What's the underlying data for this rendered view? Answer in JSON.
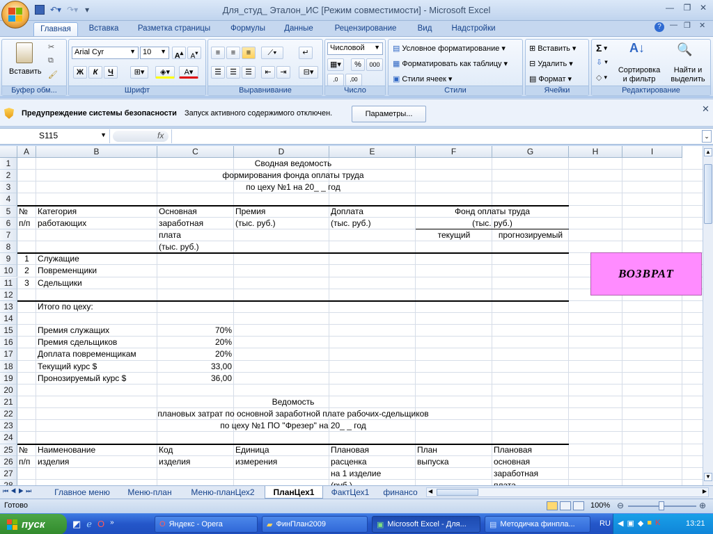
{
  "window": {
    "title": "Для_студ_ Эталон_ИС  [Режим совместимости] - Microsoft Excel"
  },
  "ribbon_tabs": [
    "Главная",
    "Вставка",
    "Разметка страницы",
    "Формулы",
    "Данные",
    "Рецензирование",
    "Вид",
    "Надстройки"
  ],
  "ribbon": {
    "clipboard": {
      "paste": "Вставить",
      "label": "Буфер обм..."
    },
    "font": {
      "name": "Arial Cyr",
      "size": "10",
      "bold": "Ж",
      "italic": "К",
      "underline": "Ч",
      "label": "Шрифт"
    },
    "alignment": {
      "label": "Выравнивание"
    },
    "number": {
      "format": "Числовой",
      "percent": "%",
      "thousands": "000",
      "label": "Число"
    },
    "styles": {
      "conditional": "Условное форматирование",
      "as_table": "Форматировать как таблицу",
      "cell_styles": "Стили ячеек",
      "label": "Стили"
    },
    "cells": {
      "insert": "Вставить",
      "delete": "Удалить",
      "format": "Формат",
      "label": "Ячейки"
    },
    "editing": {
      "sort": "Сортировка и фильтр",
      "find": "Найти и выделить",
      "label": "Редактирование"
    }
  },
  "security": {
    "title": "Предупреждение системы безопасности",
    "message": "Запуск активного содержимого отключен.",
    "button": "Параметры..."
  },
  "formula_bar": {
    "name_box": "S115",
    "fx": "fx",
    "value": ""
  },
  "columns": [
    "A",
    "B",
    "C",
    "D",
    "E",
    "F",
    "G",
    "H",
    "I"
  ],
  "rows": [
    "1",
    "2",
    "3",
    "4",
    "5",
    "6",
    "7",
    "8",
    "9",
    "10",
    "11",
    "12",
    "13",
    "14",
    "15",
    "16",
    "17",
    "18",
    "19",
    "20",
    "21",
    "22",
    "23",
    "24",
    "25",
    "26",
    "27",
    "28"
  ],
  "cells": {
    "r1": "Сводная ведомость",
    "r2": "формирования фонда оплаты труда",
    "r3": "по цеху №1 на 20_ _ год",
    "h5a": "№",
    "h6a": "п/п",
    "h5b": "Категория",
    "h6b": "работающих",
    "h5c": "Основная",
    "h6c": "заработная",
    "h7c": "плата",
    "h8c": "(тыс. руб.)",
    "h5d": "Премия",
    "h6d": "(тыс. руб.)",
    "h5e": "Доплата",
    "h6e": "(тыс. руб.)",
    "h5fg": "Фонд оплаты труда",
    "h6fg": "(тыс. руб.)",
    "h7f": "текущий",
    "h7g": "прогнозируемый",
    "r9a": "1",
    "r9b": "Служащие",
    "r10a": "2",
    "r10b": "Повременщики",
    "r11a": "3",
    "r11b": "Сдельщики",
    "r13b": "Итого по цеху:",
    "r15b": "Премия служащих",
    "r15c": "70%",
    "r16b": "Премия сдельщиков",
    "r16c": "20%",
    "r17b": "Доплата повременщикам",
    "r17c": "20%",
    "r18b": "Текущий курс $",
    "r18c": "33,00",
    "r19b": "Пронозируемый курс $",
    "r19c": "36,00",
    "r21": "Ведомость",
    "r22": "плановых затрат по основной заработной плате рабочих-сдельщиков",
    "r23": "по цеху №1 ПО \"Фрезер\" на 20_ _ год",
    "r25a": "№",
    "r26a": "п/п",
    "r25b": "Наименование",
    "r26b": "изделия",
    "r25c": "Код",
    "r26c": "изделия",
    "r25d": "Единица",
    "r26d": "измерения",
    "r25e": "Плановая",
    "r26e": "расценка",
    "r27e": "на 1 изделие",
    "r28e": "(руб.)",
    "r25f": "План",
    "r26f": "выпуска",
    "r25g": "Плановая",
    "r26g": "основная",
    "r27g": "заработная",
    "r28g": "плата"
  },
  "return_button": "ВОЗВРАТ",
  "sheet_tabs": [
    "Главное меню",
    "Меню-план",
    "Меню-планЦех2",
    "ПланЦех1",
    "ФактЦех1",
    "финансо"
  ],
  "active_sheet": "ПланЦех1",
  "status": {
    "ready": "Готово",
    "zoom": "100%"
  },
  "taskbar": {
    "start": "пуск",
    "tasks": [
      "Яндекс - Opera",
      "ФинПлан2009",
      "Microsoft Excel - Для...",
      "Методичка финпла..."
    ],
    "lang": "RU",
    "clock": "13:21"
  }
}
